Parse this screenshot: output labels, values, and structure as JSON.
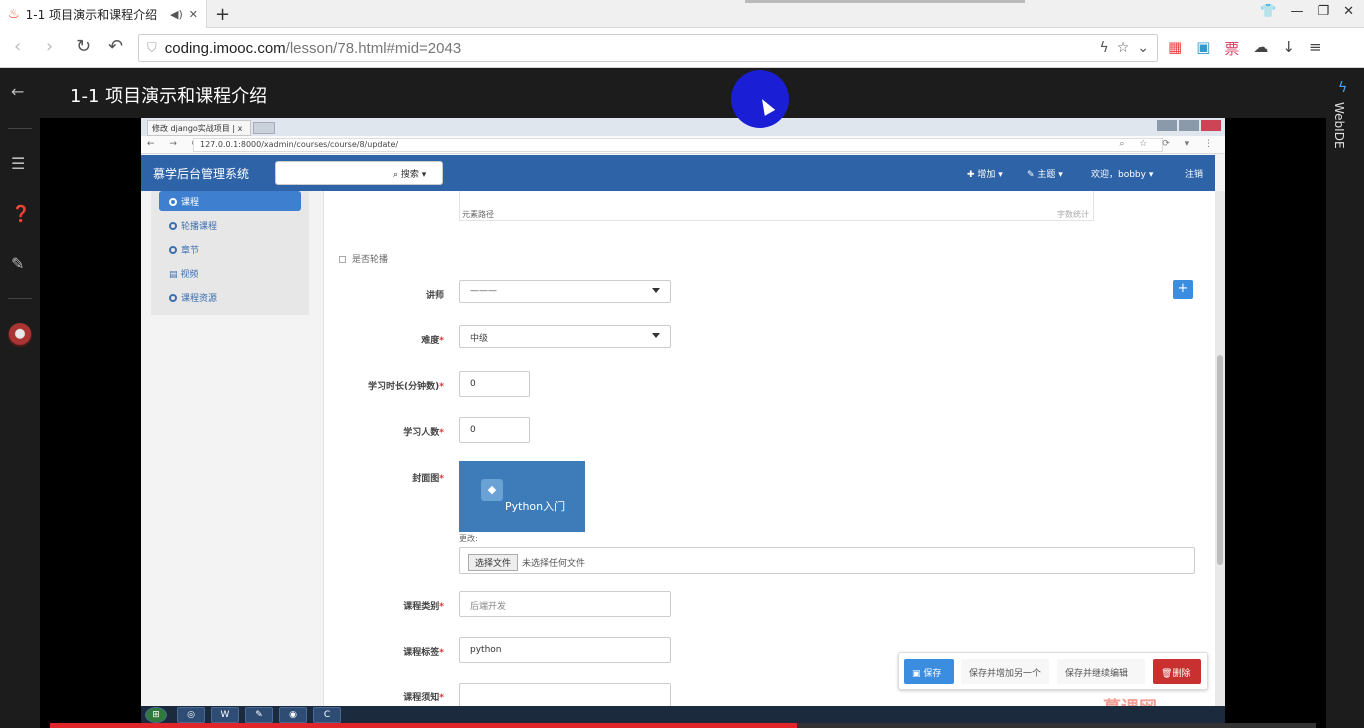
{
  "browser": {
    "tab_title": "1-1 项目演示和课程介绍",
    "tab_audio_icon": "speaker-icon",
    "tab_close": "✕",
    "new_tab": "+",
    "url_host": "coding.imooc.com",
    "url_path": "/lesson/78.html#mid=2043",
    "window_controls": [
      "shirt-icon",
      "minimize-icon",
      "maximize-icon",
      "close-icon"
    ]
  },
  "player": {
    "page_title": "1-1 项目演示和课程介绍",
    "right_rail_label": "WebIDE",
    "progress_percent": 59,
    "accent_color": "#e0262b"
  },
  "video": {
    "inner_tab_title": "修改 django实战项目 | x",
    "inner_url": "127.0.0.1:8000/xadmin/courses/course/8/update/",
    "navbar": {
      "brand": "慕学后台管理系统",
      "search_button": "搜索 ▾",
      "add": "✚ 增加 ▾",
      "theme": "✎ 主题 ▾",
      "welcome": "欢迎，bobby ▾",
      "logout": "注销",
      "color": "#2e63a8"
    },
    "sidebar": [
      {
        "label": "课程",
        "active": true
      },
      {
        "label": "轮播课程",
        "active": false
      },
      {
        "label": "章节",
        "active": false
      },
      {
        "label": "视频",
        "active": false
      },
      {
        "label": "课程资源",
        "active": false
      }
    ],
    "form": {
      "upper_left": "元素路径",
      "upper_right": "字数统计",
      "is_banner_label": "是否轮播",
      "teacher_label": "讲师",
      "teacher_value": "———",
      "degree_label": "难度",
      "degree_value": "中级",
      "learn_times_label": "学习时长(分钟数)",
      "learn_times_value": "0",
      "students_label": "学习人数",
      "students_value": "0",
      "image_label": "封面图",
      "image_caption": "Python入门",
      "change_text": "更改:",
      "choose_file": "选择文件",
      "no_file": "未选择任何文件",
      "category_label": "课程类别",
      "category_placeholder": "后端开发",
      "tag_label": "课程标签",
      "tag_value": "python",
      "notice_label": "课程须知",
      "required_mark": "*"
    },
    "actions": {
      "save": "保存",
      "save_add": "保存并增加另一个",
      "save_continue": "保存并继续编辑",
      "delete": "删除"
    },
    "watermark": "慕课网"
  }
}
